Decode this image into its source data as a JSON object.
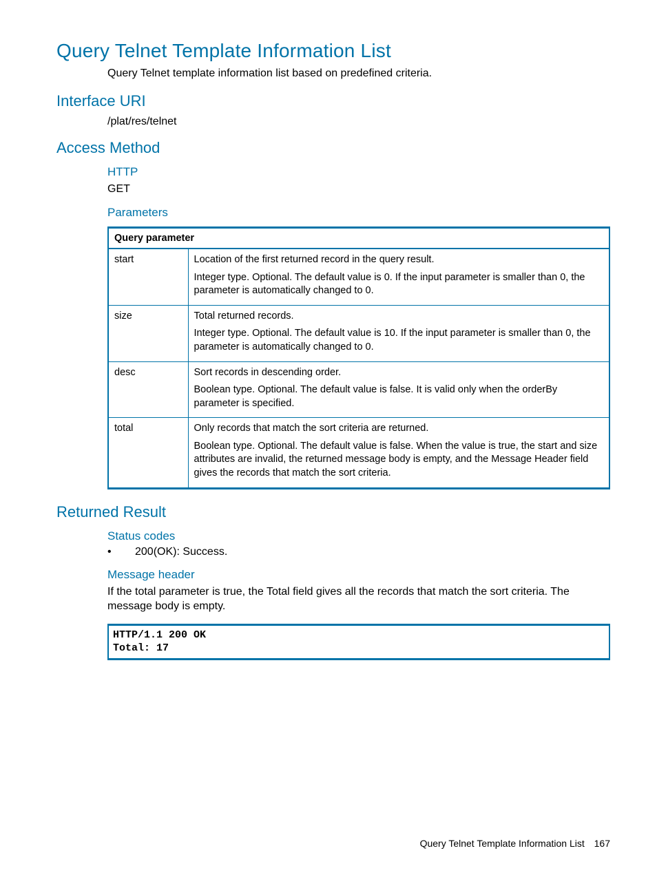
{
  "title": "Query Telnet Template Information List",
  "intro": "Query Telnet template information list based on predefined criteria.",
  "section_interface_uri": "Interface URI",
  "interface_uri_value": "/plat/res/telnet",
  "section_access_method": "Access Method",
  "http_heading": "HTTP",
  "http_method": "GET",
  "parameters_heading": "Parameters",
  "table": {
    "header": "Query parameter",
    "rows": [
      {
        "name": "start",
        "p1": "Location of the first returned record in the query result.",
        "p2": "Integer type. Optional. The default value is 0. If the input parameter is smaller than 0, the parameter is automatically changed to 0."
      },
      {
        "name": "size",
        "p1": "Total returned records.",
        "p2": "Integer type. Optional. The default value is 10. If the input parameter is smaller than 0, the parameter is automatically changed to 0."
      },
      {
        "name": "desc",
        "p1": "Sort records in descending order.",
        "p2": "Boolean type. Optional. The default value is false. It is valid only when the orderBy parameter is specified."
      },
      {
        "name": "total",
        "p1": "Only records that match the sort criteria are returned.",
        "p2": "Boolean type. Optional. The default value is false. When the value is true, the start and size attributes are invalid, the returned message body is empty, and the Message Header field gives the records that match the sort criteria."
      }
    ]
  },
  "section_returned_result": "Returned Result",
  "status_codes_heading": "Status codes",
  "status_code_item": "200(OK): Success.",
  "message_header_heading": "Message header",
  "message_header_text": "If the total parameter is true, the Total field gives all the records that match the sort criteria. The message body is empty.",
  "code_block": "HTTP/1.1 200 OK\nTotal: 17",
  "footer_title": "Query Telnet Template Information List",
  "footer_page": "167"
}
